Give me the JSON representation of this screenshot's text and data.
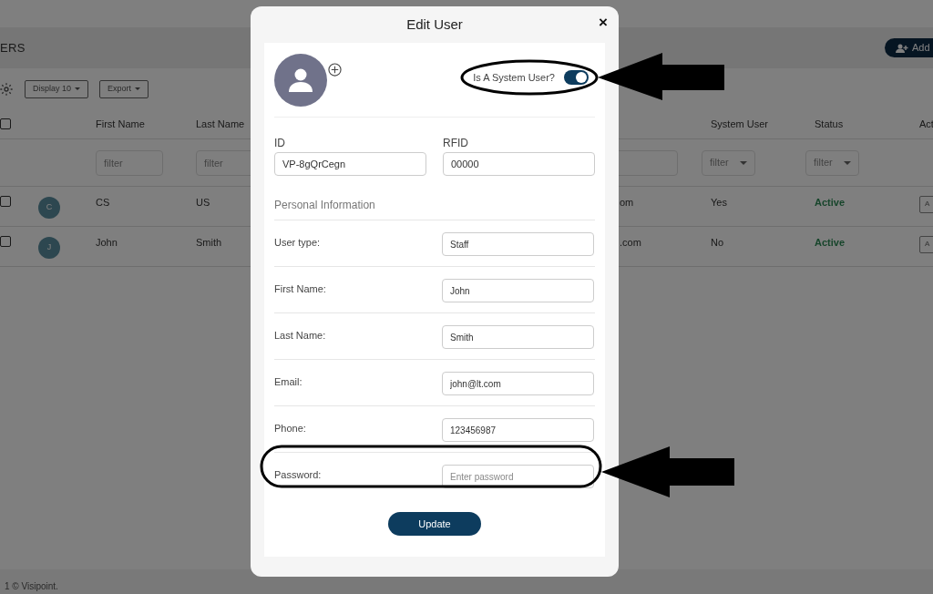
{
  "page": {
    "title": "ERS",
    "add_button": "Add",
    "toolbar": {
      "display": "Display 10",
      "export": "Export"
    },
    "table": {
      "header_checked": false,
      "columns": {
        "first_name": "First Name",
        "last_name": "Last Name",
        "system_user": "System User",
        "status": "Status",
        "actions": "Act"
      },
      "filters": {
        "first_name": {
          "kind": "text",
          "placeholder": "filter"
        },
        "last_name": {
          "kind": "text",
          "placeholder": "filter"
        },
        "email": {
          "kind": "text"
        },
        "system_user": {
          "kind": "select",
          "placeholder": "filter"
        },
        "status": {
          "kind": "select",
          "placeholder": "filter"
        }
      },
      "rows": [
        {
          "checked": false,
          "initial": "C",
          "first_name": "CS",
          "last_name": "US",
          "email": "om",
          "system_user": "Yes",
          "status": "Active",
          "action": "A"
        },
        {
          "checked": false,
          "initial": "J",
          "first_name": "John",
          "last_name": "Smith",
          "email": ".com",
          "system_user": "No",
          "status": "Active",
          "action": "A"
        }
      ]
    },
    "footer": "1 © Visipoint."
  },
  "dialog": {
    "title": "Edit User",
    "close": "×",
    "system_user": {
      "label": "Is A System User?",
      "on": true
    },
    "id": {
      "label": "ID",
      "value": "VP-8gQrCegn"
    },
    "rfid": {
      "label": "RFID",
      "value": "00000"
    },
    "section": "Personal Information",
    "fields": [
      {
        "label": "User type:",
        "value": "Staff"
      },
      {
        "label": "First Name:",
        "value": "John"
      },
      {
        "label": "Last Name:",
        "value": "Smith"
      },
      {
        "label": "Email:",
        "value": "john@lt.com"
      },
      {
        "label": "Phone:",
        "value": "123456987"
      },
      {
        "label": "Password:",
        "placeholder": "Enter password"
      }
    ],
    "button": "Update"
  }
}
